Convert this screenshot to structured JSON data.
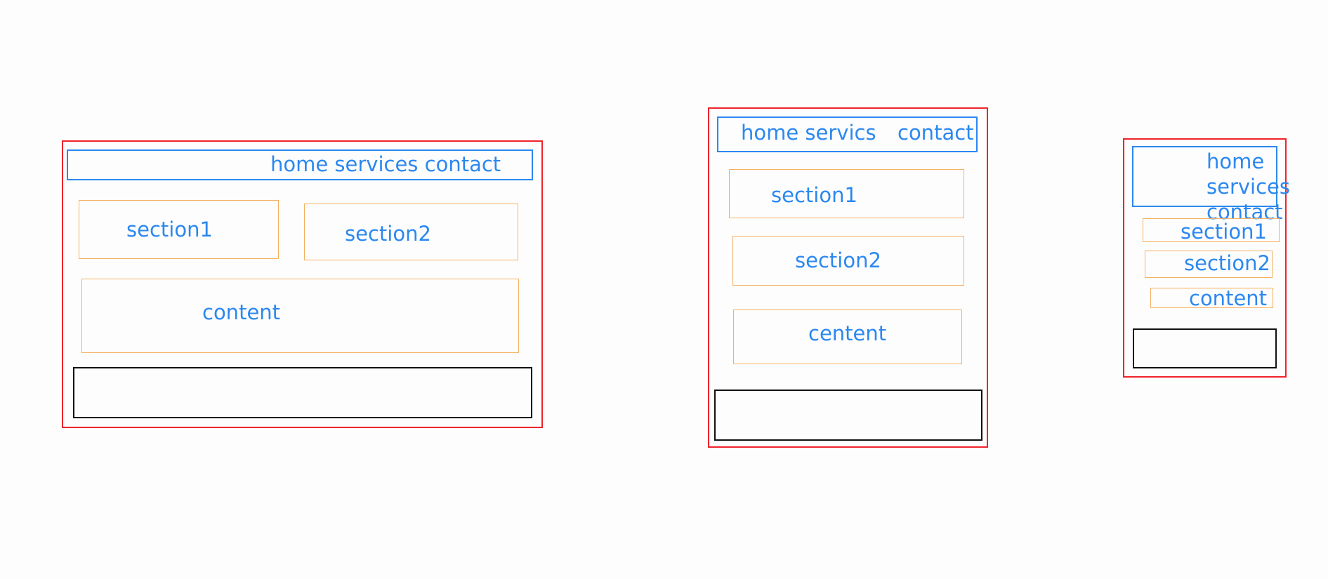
{
  "layouts": [
    {
      "nav_label": "home services contact",
      "section1": "section1",
      "section2": "section2",
      "content": "content"
    },
    {
      "nav_home_services": "home servics",
      "nav_contact": "contact",
      "section1": "section1",
      "section2": "section2",
      "content": "centent"
    },
    {
      "nav_items": [
        "home",
        "services",
        "contact"
      ],
      "section1": "section1",
      "section2": "section2",
      "content": "content"
    }
  ],
  "colors": {
    "container": "#f0232a",
    "nav": "#2b88f0",
    "section": "#f5b061",
    "footer": "#111111",
    "text": "#2b88f0"
  }
}
